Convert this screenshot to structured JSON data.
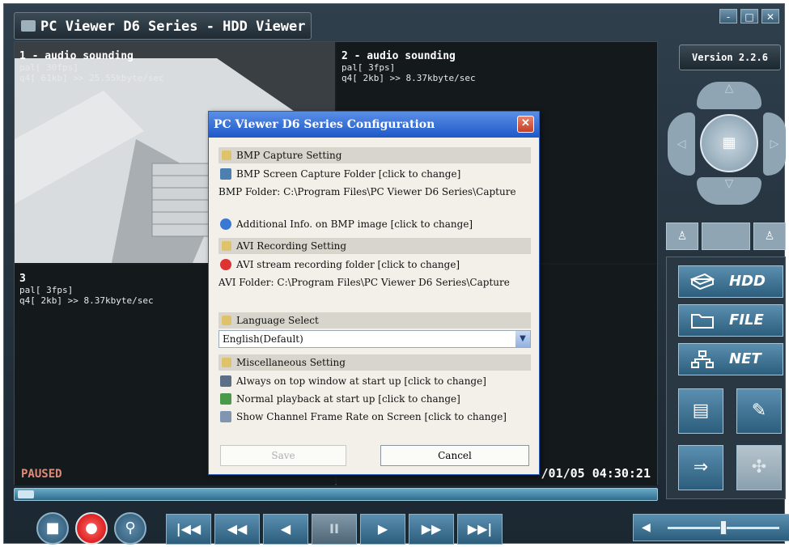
{
  "window": {
    "title": "PC Viewer D6 Series - HDD Viewer",
    "controls": [
      "-",
      "□",
      "✕"
    ]
  },
  "channels": [
    {
      "title": "1 - audio sounding",
      "line1": "pal[ 30fps]",
      "line2": "q4[ 61kb] >> 25.55kbyte/sec"
    },
    {
      "title": "2 - audio sounding",
      "line1": "pal[ 3fps]",
      "line2": "q4[ 2kb] >> 8.37kbyte/sec"
    },
    {
      "title": "3",
      "line1": "pal[ 3fps]",
      "line2": "q4[ 2kb] >> 8.37kbyte/sec"
    }
  ],
  "status": {
    "state": "PAUSED",
    "datetime": "---/01/05 04:30:21"
  },
  "sidebar": {
    "version": "Version 2.2.6",
    "modes": [
      {
        "label": "HDD",
        "icon": "hdd-icon"
      },
      {
        "label": "FILE",
        "icon": "folder-icon"
      },
      {
        "label": "NET",
        "icon": "network-icon"
      }
    ]
  },
  "playback": {
    "buttons": [
      "|◀◀",
      "◀◀",
      "◀",
      "II",
      "▶",
      "▶▶",
      "▶▶|"
    ],
    "volume_level": 0.5
  },
  "dialog": {
    "title": "PC Viewer D6 Series Configuration",
    "close": "✕",
    "bmp_section": "BMP Capture Setting",
    "bmp_folder_link": "BMP Screen Capture Folder [click to change]",
    "bmp_folder_path": "BMP Folder: C:\\Program Files\\PC Viewer D6 Series\\Capture",
    "bmp_info_link": "Additional Info. on BMP image [click to change]",
    "avi_section": "AVI Recording Setting",
    "avi_folder_link": "AVI stream recording folder [click to change]",
    "avi_folder_path": "AVI Folder: C:\\Program Files\\PC Viewer D6 Series\\Capture",
    "lang_section": "Language Select",
    "lang_value": "English(Default)",
    "misc_section": "Miscellaneous Setting",
    "misc_items": [
      "Always on top window at start up [click to change]",
      "Normal playback at start up [click to change]",
      "Show Channel Frame Rate on Screen [click to change]"
    ],
    "save_label": "Save",
    "cancel_label": "Cancel"
  }
}
